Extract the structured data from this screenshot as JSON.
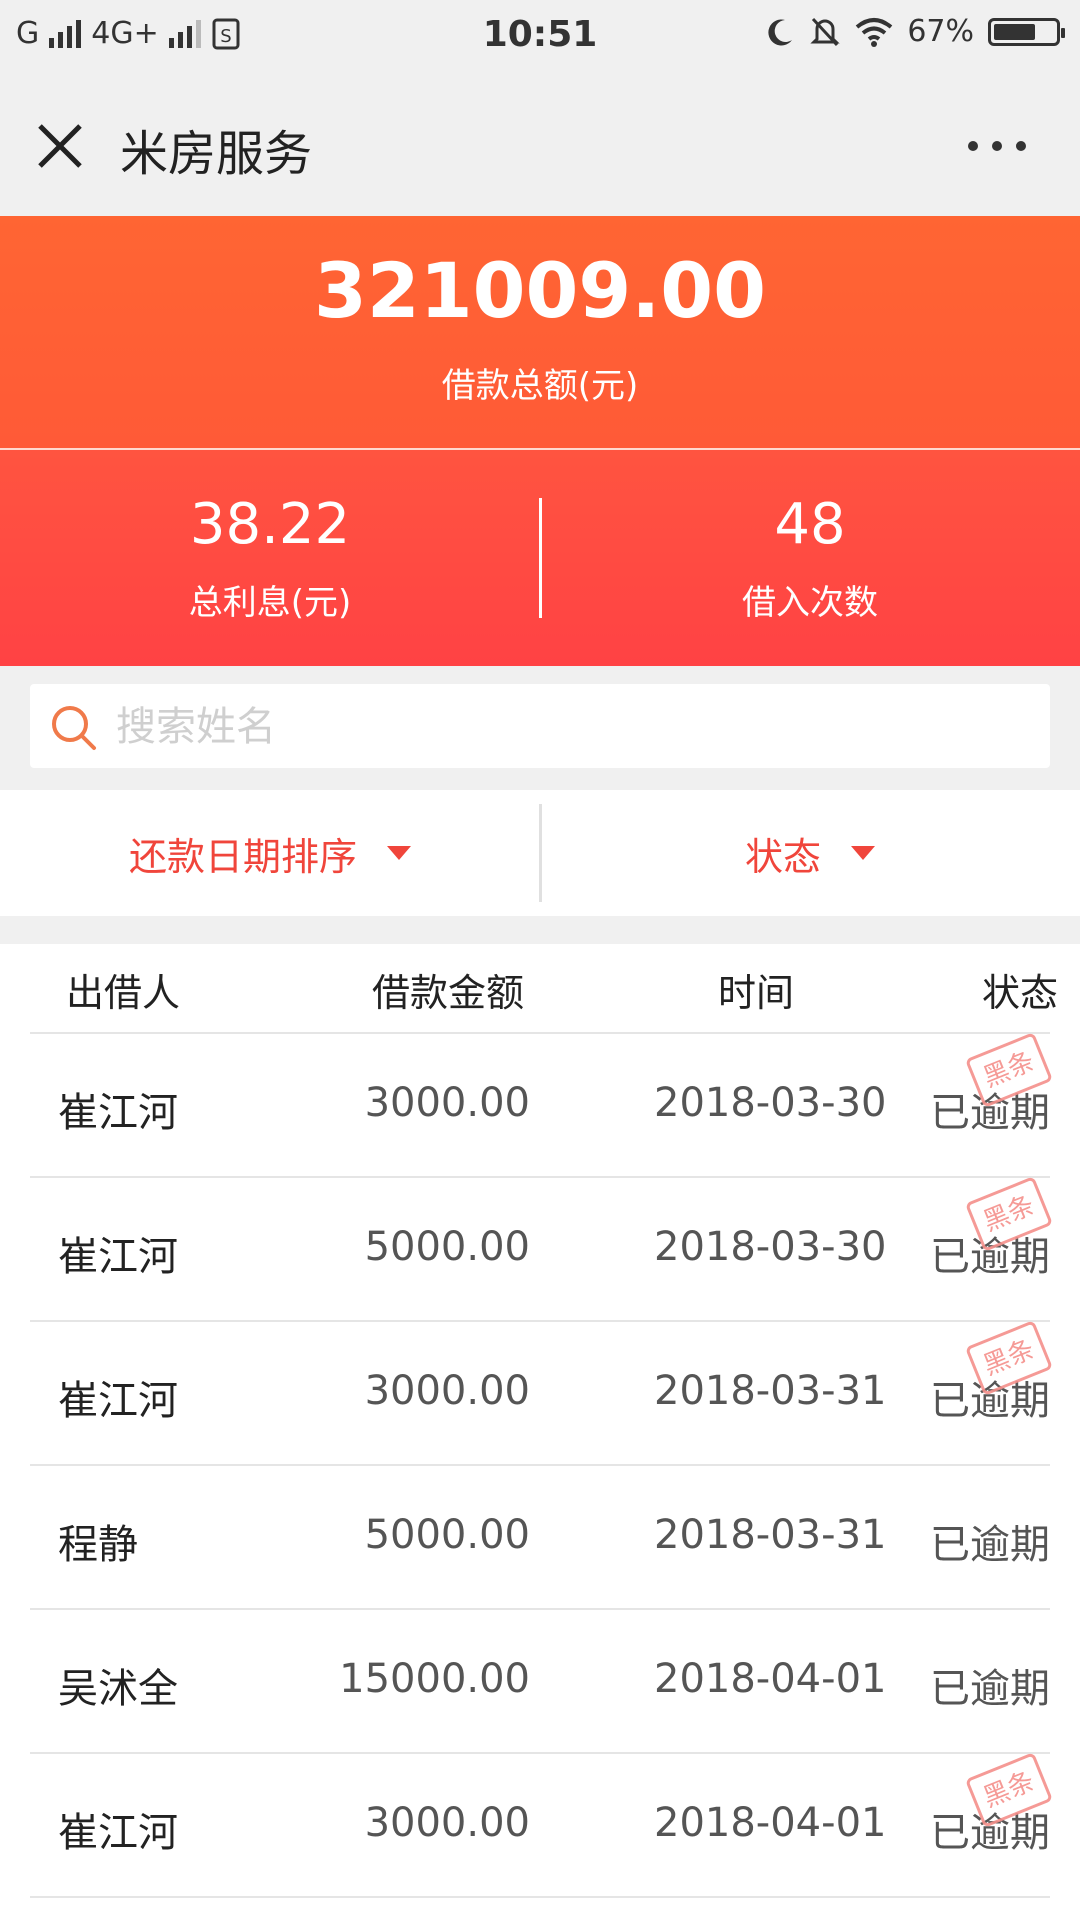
{
  "status_bar": {
    "left_text": "G",
    "network": "4G+",
    "time": "10:51",
    "battery": "67%"
  },
  "nav": {
    "title": "米房服务"
  },
  "summary": {
    "total_amount": "321009.00",
    "total_label": "借款总额(元)",
    "interest_value": "38.22",
    "interest_label": "总利息(元)",
    "count_value": "48",
    "count_label": "借入次数"
  },
  "search": {
    "placeholder": "搜索姓名"
  },
  "filters": {
    "sort_label": "还款日期排序",
    "status_label": "状态"
  },
  "table": {
    "headers": [
      "出借人",
      "借款金额",
      "时间",
      "状态"
    ],
    "stamp_text": "黑条",
    "rows": [
      {
        "lender": "崔江河",
        "amount": "3000.00",
        "date": "2018-03-30",
        "status": "已逾期",
        "blacklisted": true
      },
      {
        "lender": "崔江河",
        "amount": "5000.00",
        "date": "2018-03-30",
        "status": "已逾期",
        "blacklisted": true
      },
      {
        "lender": "崔江河",
        "amount": "3000.00",
        "date": "2018-03-31",
        "status": "已逾期",
        "blacklisted": true
      },
      {
        "lender": "程静",
        "amount": "5000.00",
        "date": "2018-03-31",
        "status": "已逾期",
        "blacklisted": false
      },
      {
        "lender": "吴沭全",
        "amount": "15000.00",
        "date": "2018-04-01",
        "status": "已逾期",
        "blacklisted": false
      },
      {
        "lender": "崔江河",
        "amount": "3000.00",
        "date": "2018-04-01",
        "status": "已逾期",
        "blacklisted": true
      }
    ]
  },
  "colors": {
    "accent": "#f0453b",
    "header_top": "#ff6533",
    "header_bottom": "#ff4244"
  }
}
